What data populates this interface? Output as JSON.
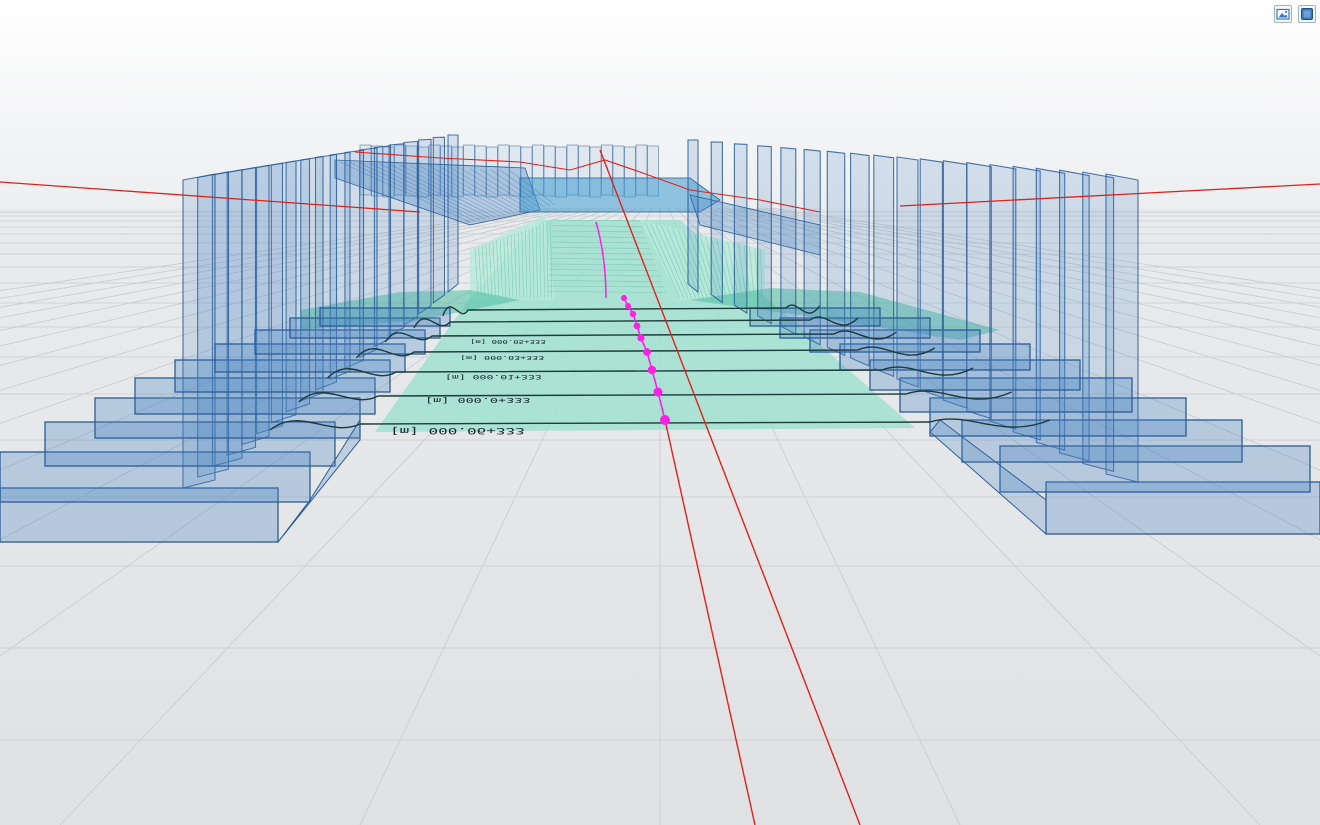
{
  "toolbar": {
    "buttons": [
      {
        "icon": "screenshot-icon"
      },
      {
        "icon": "cube-view-icon"
      }
    ]
  },
  "colors": {
    "background_top": "#ffffff",
    "background_floor": "#e3e5e7",
    "grid": "#c8cbcf",
    "wall_fill": "#4a86c4",
    "wall_stroke": "#2a5d99",
    "cut_fill": "#9fe0cf",
    "contour": "#1d3b3a",
    "alignment": "#e0221c",
    "station_marker": "#ff20e6",
    "toolbar_accent": "#3a78bd"
  },
  "scene": {
    "station_labels": [
      "[m] 000.06+333",
      "[m] 000.0+333",
      "[m] 000.01+333",
      "[m] 000.03+333",
      "[m] 000.05+333"
    ]
  }
}
